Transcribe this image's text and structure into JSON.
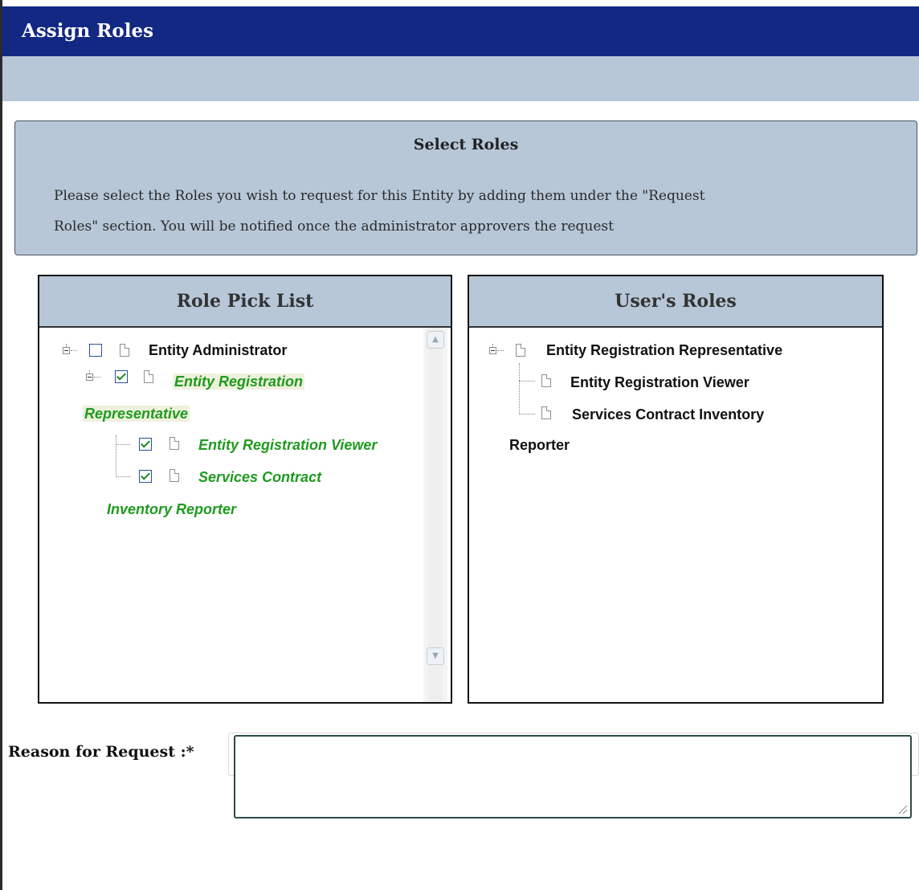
{
  "header": {
    "title": "Assign Roles"
  },
  "info": {
    "title": "Select Roles",
    "text_line1": "Please select the Roles you wish to request for this Entity by adding them under the \"Request",
    "text_line2": "Roles\" section. You will be notified once the administrator approvers the request"
  },
  "pick_list": {
    "title": "Role Pick List",
    "items": [
      {
        "label": "Entity Administrator",
        "checked": false
      },
      {
        "label_line1": "Entity Registration",
        "label_line2": "Representative",
        "checked": true
      },
      {
        "label": "Entity Registration Viewer",
        "checked": true
      },
      {
        "label_line1": "Services Contract",
        "label_line2": "Inventory Reporter",
        "checked": true
      }
    ]
  },
  "user_roles": {
    "title": "User's Roles",
    "items": [
      {
        "label": "Entity Registration Representative"
      },
      {
        "label": "Entity Registration Viewer"
      },
      {
        "label_line1": "Services Contract Inventory",
        "label_line2": "Reporter"
      }
    ]
  },
  "reason": {
    "label": "Reason for Request :*",
    "value": ""
  },
  "colors": {
    "title_bar": "#122882",
    "panel_bg": "#b7c7d8",
    "selected_text": "#1f9a1f"
  }
}
